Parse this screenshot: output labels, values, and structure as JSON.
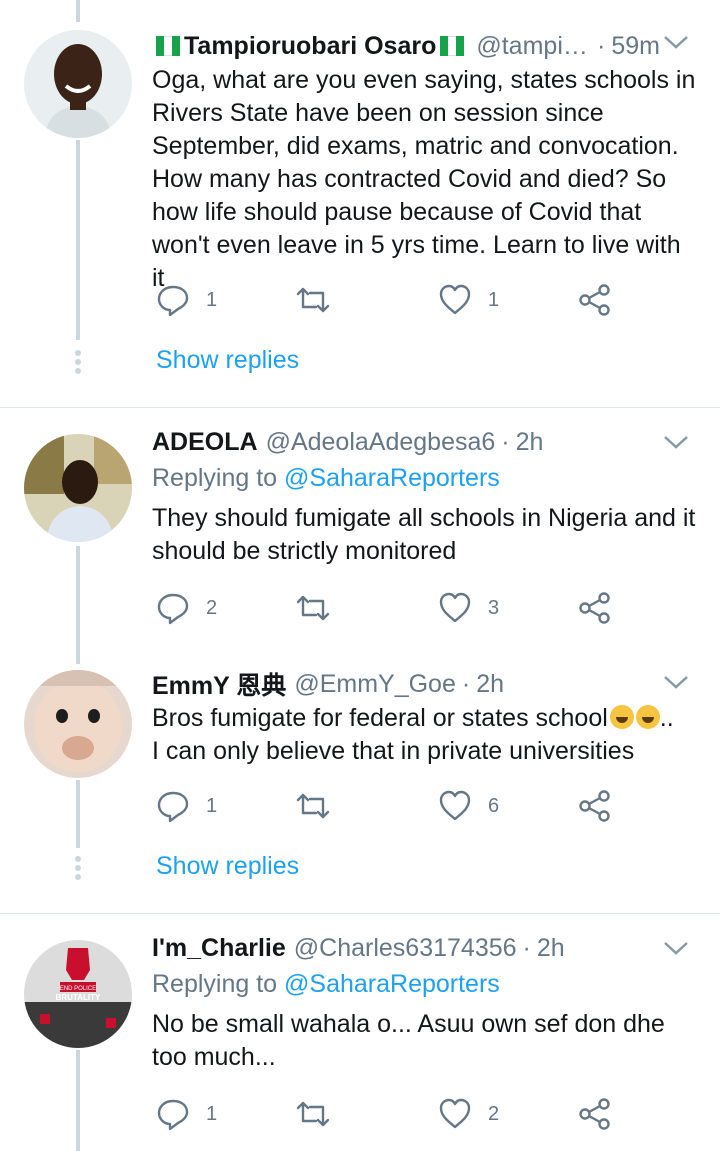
{
  "tweets": [
    {
      "name": "Tampioruobari Osaro",
      "handle": "@tampio...",
      "time": "59m",
      "text": "Oga, what are you even saying, states schools in Rivers State have been on session since September, did exams, matric and convocation. How many has  contracted Covid and died? So how life should pause because of Covid that won't even leave in 5 yrs time. Learn to live with it",
      "reply_count": "1",
      "like_count": "1",
      "show_replies": "Show replies"
    },
    {
      "name": "ADEOLA",
      "handle": "@AdeolaAdegbesa6",
      "time": "2h",
      "replying_prefix": "Replying to",
      "replying_to": "@SaharaReporters",
      "text": "They should fumigate all schools in Nigeria and it should be strictly monitored",
      "reply_count": "2",
      "like_count": "3"
    },
    {
      "name": "EmmY 恩典",
      "handle": "@EmmY_Goe",
      "time": "2h",
      "text_line1": "Bros fumigate for federal or states school",
      "text_line1_end": "..",
      "text_line2": "I can only believe that in private universities",
      "reply_count": "1",
      "like_count": "6",
      "show_replies": "Show replies"
    },
    {
      "name": "I'm_Charlie",
      "handle": "@Charles63174356",
      "time": "2h",
      "replying_prefix": "Replying to",
      "replying_to": "@SaharaReporters",
      "text": "No be small wahala o... Asuu own sef don dhe too much...",
      "reply_count": "1",
      "like_count": "2",
      "avatar_text_top": "END POLICE",
      "avatar_text_bottom": "BRUTALITY"
    }
  ],
  "separator_dot": "·",
  "colors": {
    "accent": "#1da1f2",
    "muted": "#657786",
    "text": "#14171a",
    "divider": "#e1e8ed",
    "thread_line": "#ccd6dd"
  },
  "icons": [
    "reply-icon",
    "retweet-icon",
    "like-icon",
    "share-icon",
    "caret-down-icon",
    "nigeria-flag-icon"
  ]
}
